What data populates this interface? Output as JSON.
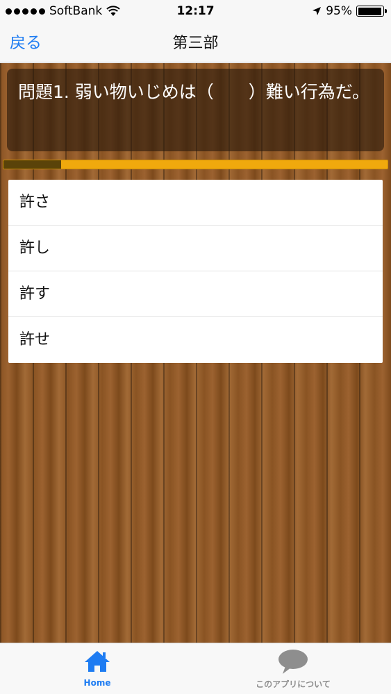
{
  "status_bar": {
    "carrier": "SoftBank",
    "time": "12:17",
    "battery": "95%",
    "battery_level": 0.95
  },
  "nav": {
    "back_label": "戻る",
    "title": "第三部"
  },
  "question": {
    "text": "問題1. 弱い物いじめは（　　）難い行為だ。"
  },
  "progress": {
    "fraction": 0.15
  },
  "answers": [
    {
      "label": "許さ"
    },
    {
      "label": "許し"
    },
    {
      "label": "許す"
    },
    {
      "label": "許せ"
    }
  ],
  "tab_bar": {
    "tabs": [
      {
        "label": "Home",
        "icon": "home-icon",
        "active": true
      },
      {
        "label": "このアプリについて",
        "icon": "speech-bubble-icon",
        "active": false
      }
    ]
  },
  "colors": {
    "accent": "#1e7cf2",
    "progress_fill": "#5a4309",
    "progress_track": "#f0a90d"
  }
}
